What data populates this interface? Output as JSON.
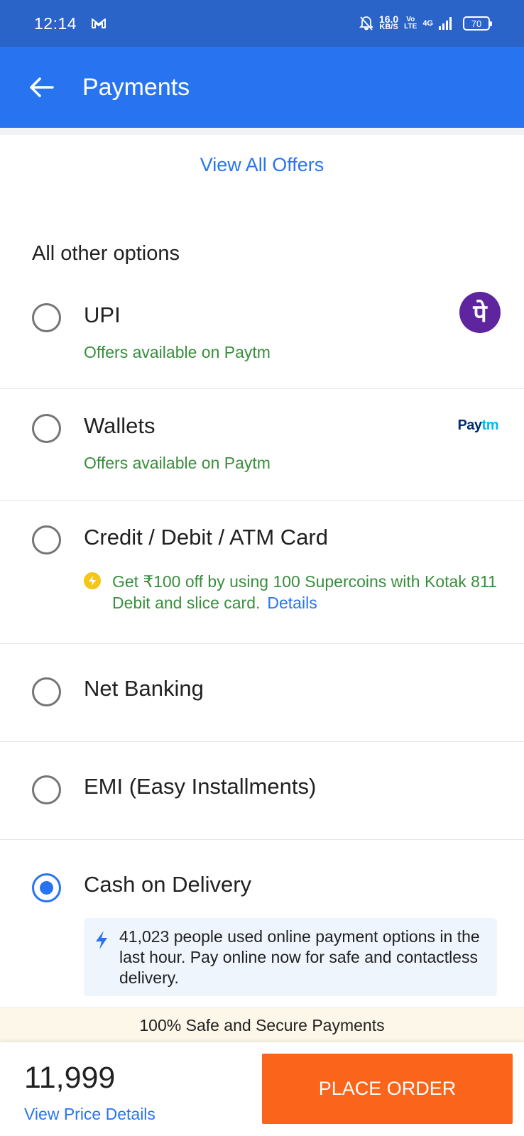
{
  "status_bar": {
    "time": "12:14",
    "net_speed": "16.0",
    "net_speed_unit": "KB/S",
    "volte_top": "Vo",
    "volte_bottom": "LTE",
    "network": "4G",
    "battery": "70"
  },
  "app_bar": {
    "title": "Payments"
  },
  "offers": {
    "link_label": "View All Offers"
  },
  "options_section": {
    "title": "All other options",
    "items": [
      {
        "label": "UPI",
        "offer": "Offers available on Paytm",
        "logo": "phonepe-icon",
        "logo_glyph": "पे",
        "selected": false
      },
      {
        "label": "Wallets",
        "offer": "Offers available on Paytm",
        "logo_pay": "Pay",
        "logo_tm": "tm",
        "selected": false
      },
      {
        "label": "Credit / Debit / ATM Card",
        "offer": "Get ₹100 off by using 100 Supercoins with Kotak 811 Debit and slice card.",
        "offer_link": "Details",
        "selected": false
      },
      {
        "label": "Net Banking",
        "selected": false
      },
      {
        "label": "EMI (Easy Installments)",
        "selected": false
      },
      {
        "label": "Cash on Delivery",
        "info": "41,023 people used online payment options in the last hour. Pay online now for safe and contactless delivery.",
        "selected": true
      }
    ]
  },
  "secure_strip": {
    "text": "100% Safe and Secure Payments"
  },
  "footer": {
    "total": "11,999",
    "price_details_label": "View Price Details",
    "place_order_label": "PLACE ORDER"
  },
  "colors": {
    "primary": "#2874f0",
    "status_bar": "#2a64c8",
    "offer_green": "#388e3c",
    "place_order": "#fb641b",
    "phonepe": "#5f259f"
  }
}
